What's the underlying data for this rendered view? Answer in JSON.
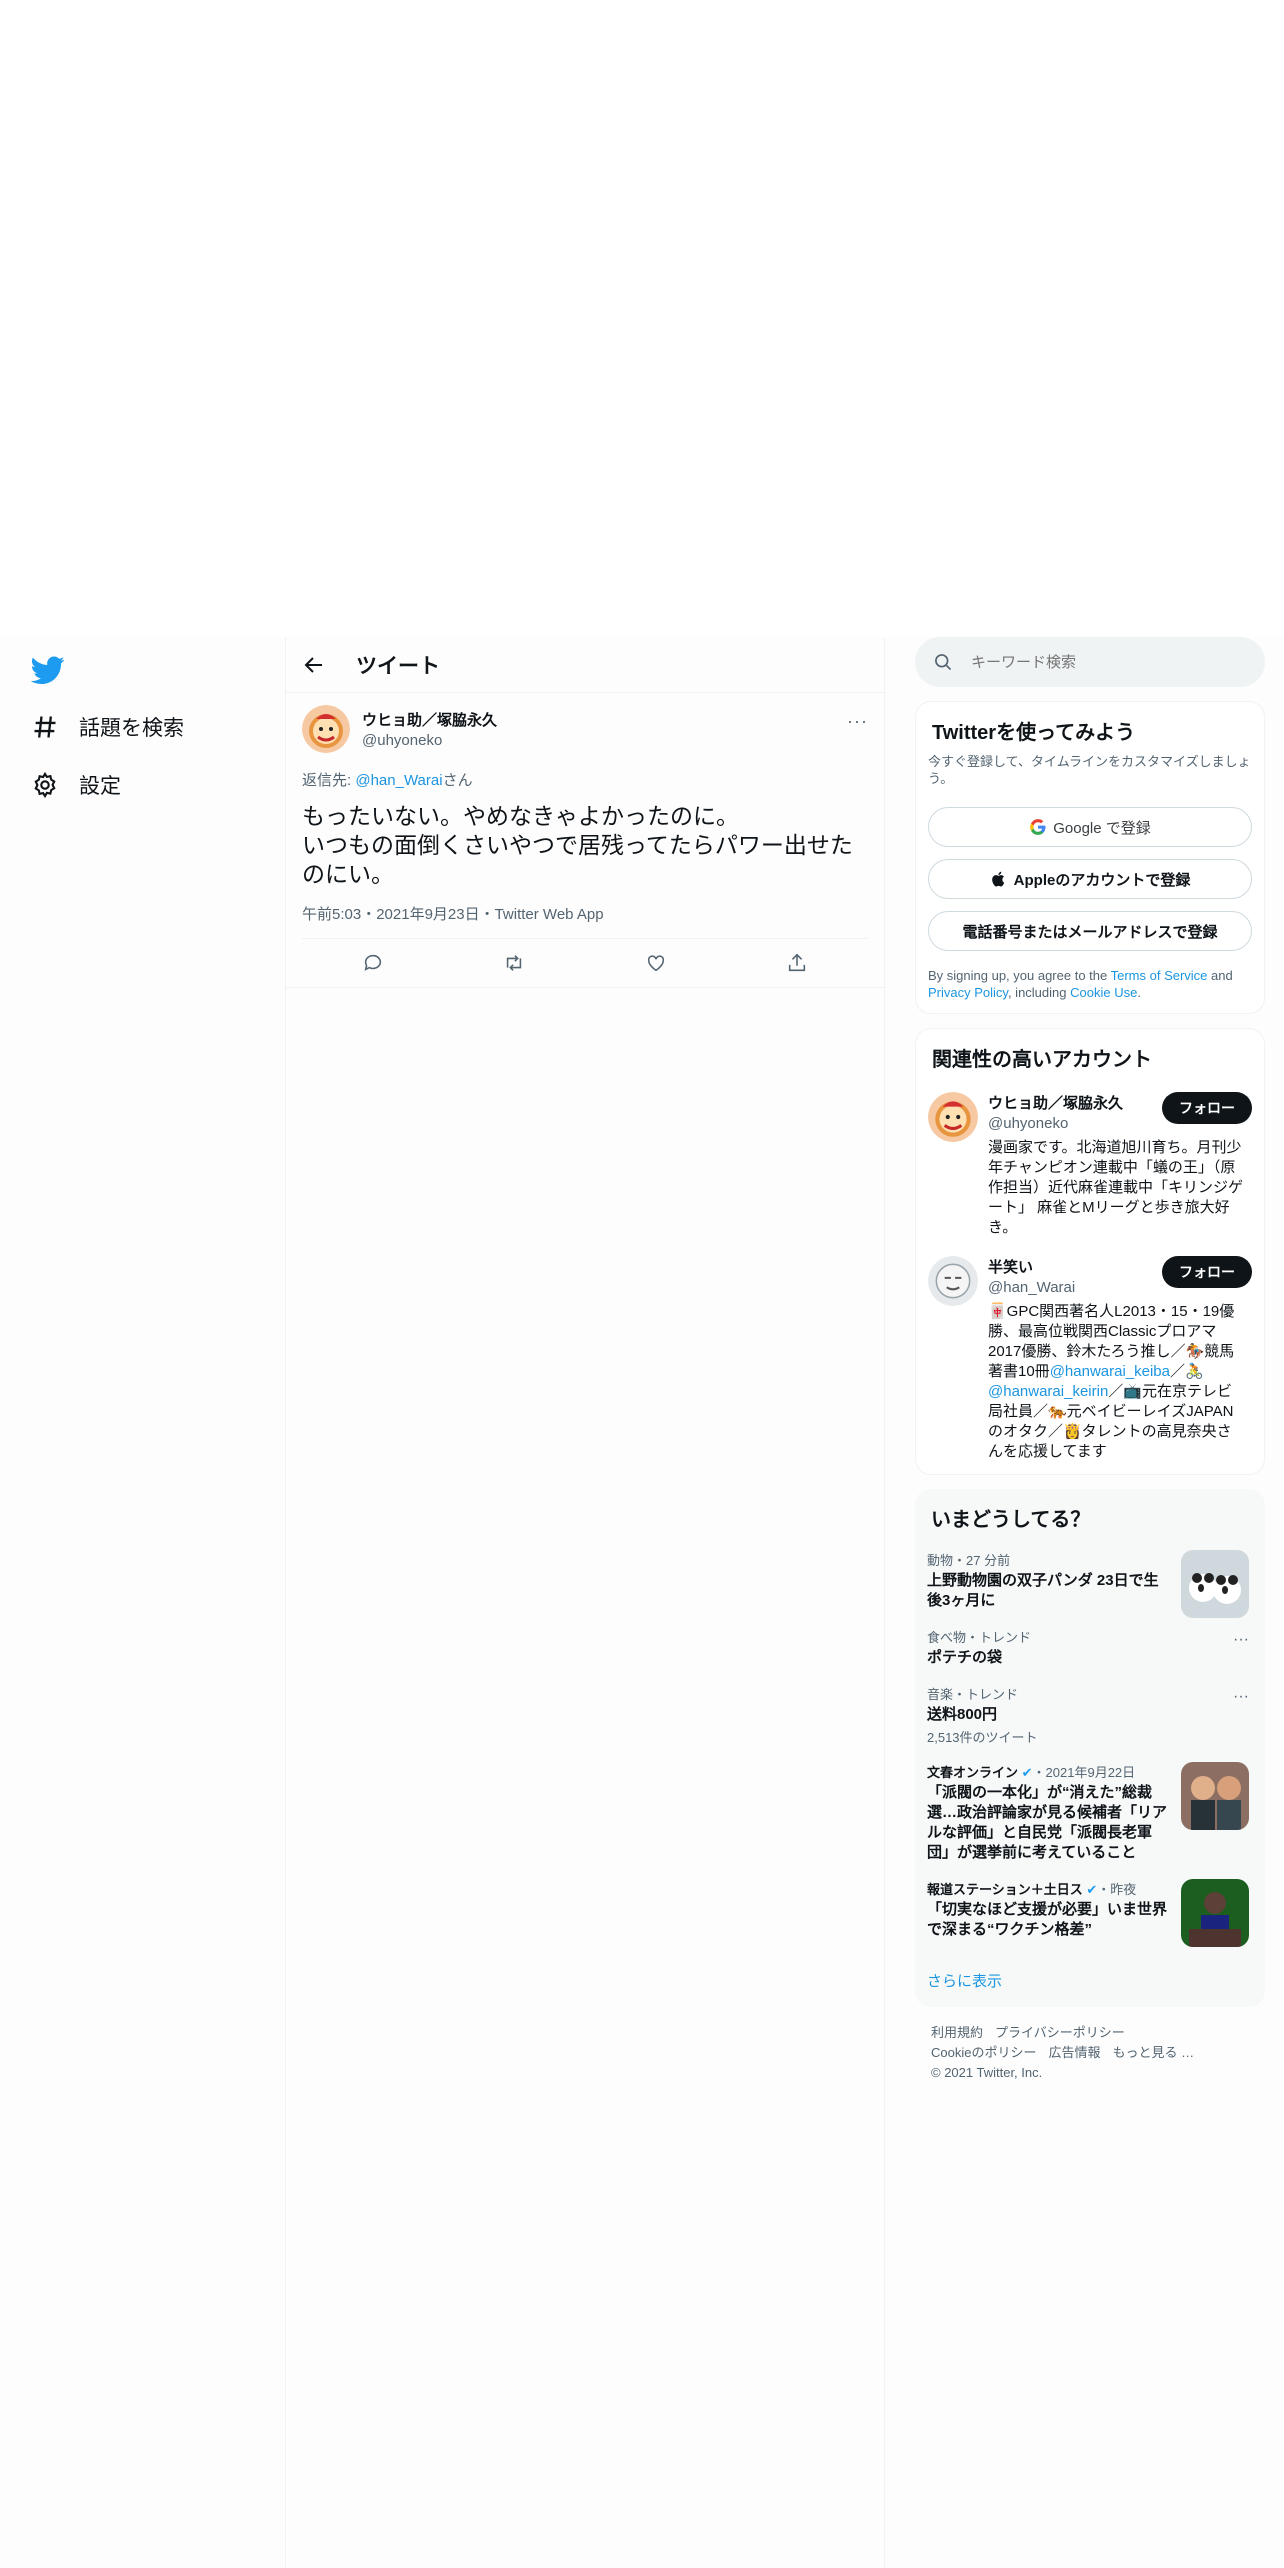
{
  "nav": {
    "explore": "話題を検索",
    "settings": "設定"
  },
  "header": {
    "title": "ツイート"
  },
  "tweet": {
    "name": "ウヒョ助／塚脇永久",
    "handle": "@uhyoneko",
    "reply_prefix": "返信先: ",
    "reply_handle": "@han_Warai",
    "reply_suffix": "さん",
    "text": "もったいない。やめなきゃよかったのに。\nいつもの面倒くさいやつで居残ってたらパワー出せたのにい。",
    "meta": "午前5:03・2021年9月23日・Twitter Web App",
    "more": "···"
  },
  "search": {
    "placeholder": "キーワード検索"
  },
  "signup": {
    "title": "Twitterを使ってみよう",
    "subtitle": "今すぐ登録して、タイムラインをカスタマイズしましょう。",
    "google": "Google で登録",
    "apple": "Appleのアカウントで登録",
    "phone": "電話番号またはメールアドレスで登録",
    "terms_prefix": "By signing up, you agree to the ",
    "terms_tos": "Terms of Service",
    "terms_and": " and ",
    "terms_privacy": "Privacy Policy",
    "terms_including": ", including ",
    "terms_cookie": "Cookie Use",
    "terms_end": "."
  },
  "related": {
    "title": "関連性の高いアカウント",
    "follow_label": "フォロー",
    "accounts": [
      {
        "name": "ウヒョ助／塚脇永久",
        "handle": "@uhyoneko",
        "bio": "漫画家です。北海道旭川育ち。月刊少年チャンピオン連載中「蟻の王」（原作担当）近代麻雀連載中「キリンジゲート」 麻雀とMリーグと歩き旅大好き。"
      },
      {
        "name": "半笑い",
        "handle": "@han_Warai",
        "bio_1": "🀄GPC関西著名人L2013・15・19優勝、最高位戦関西Classicプロアマ2017優勝、鈴木たろう推し／🏇競馬著書10冊",
        "bio_link1": "@hanwarai_keiba",
        "bio_2": "／🚴",
        "bio_link2": "@hanwarai_keirin",
        "bio_3": "／📺元在京テレビ局社員／🐅元ベイビーレイズJAPANのオタク／👸タレントの高見奈央さんを応援してます"
      }
    ]
  },
  "trends": {
    "title": "いまどうしてる？",
    "items": [
      {
        "category": "動物・27 分前",
        "title": "上野動物園の双子パンダ 23日で生後3ヶ月に"
      },
      {
        "category": "食べ物・トレンド",
        "title": "ポテチの袋"
      },
      {
        "category": "音楽・トレンド",
        "title": "送料800円",
        "count": "2,513件のツイート"
      },
      {
        "source": "文春オンライン",
        "time": "・2021年9月22日",
        "title": "「派閥の一本化」が“消えた”総裁選…政治評論家が見る候補者「リアルな評価」と自民党「派閥長老軍団」が選挙前に考えていること"
      },
      {
        "source": "報道ステーション＋土日ス",
        "time": "・昨夜",
        "title": "「切実なほど支援が必要」いま世界で深まる“ワクチン格差”"
      }
    ],
    "show_more": "さらに表示"
  },
  "footer": {
    "links": [
      "利用規約",
      "プライバシーポリシー",
      "Cookieのポリシー",
      "広告情報",
      "もっと見る …"
    ],
    "copyright": "© 2021 Twitter, Inc."
  },
  "colors": {
    "accent": "#1d9bf0",
    "link": "#1b95e0",
    "text": "#0f1419",
    "secondary": "#536471"
  }
}
